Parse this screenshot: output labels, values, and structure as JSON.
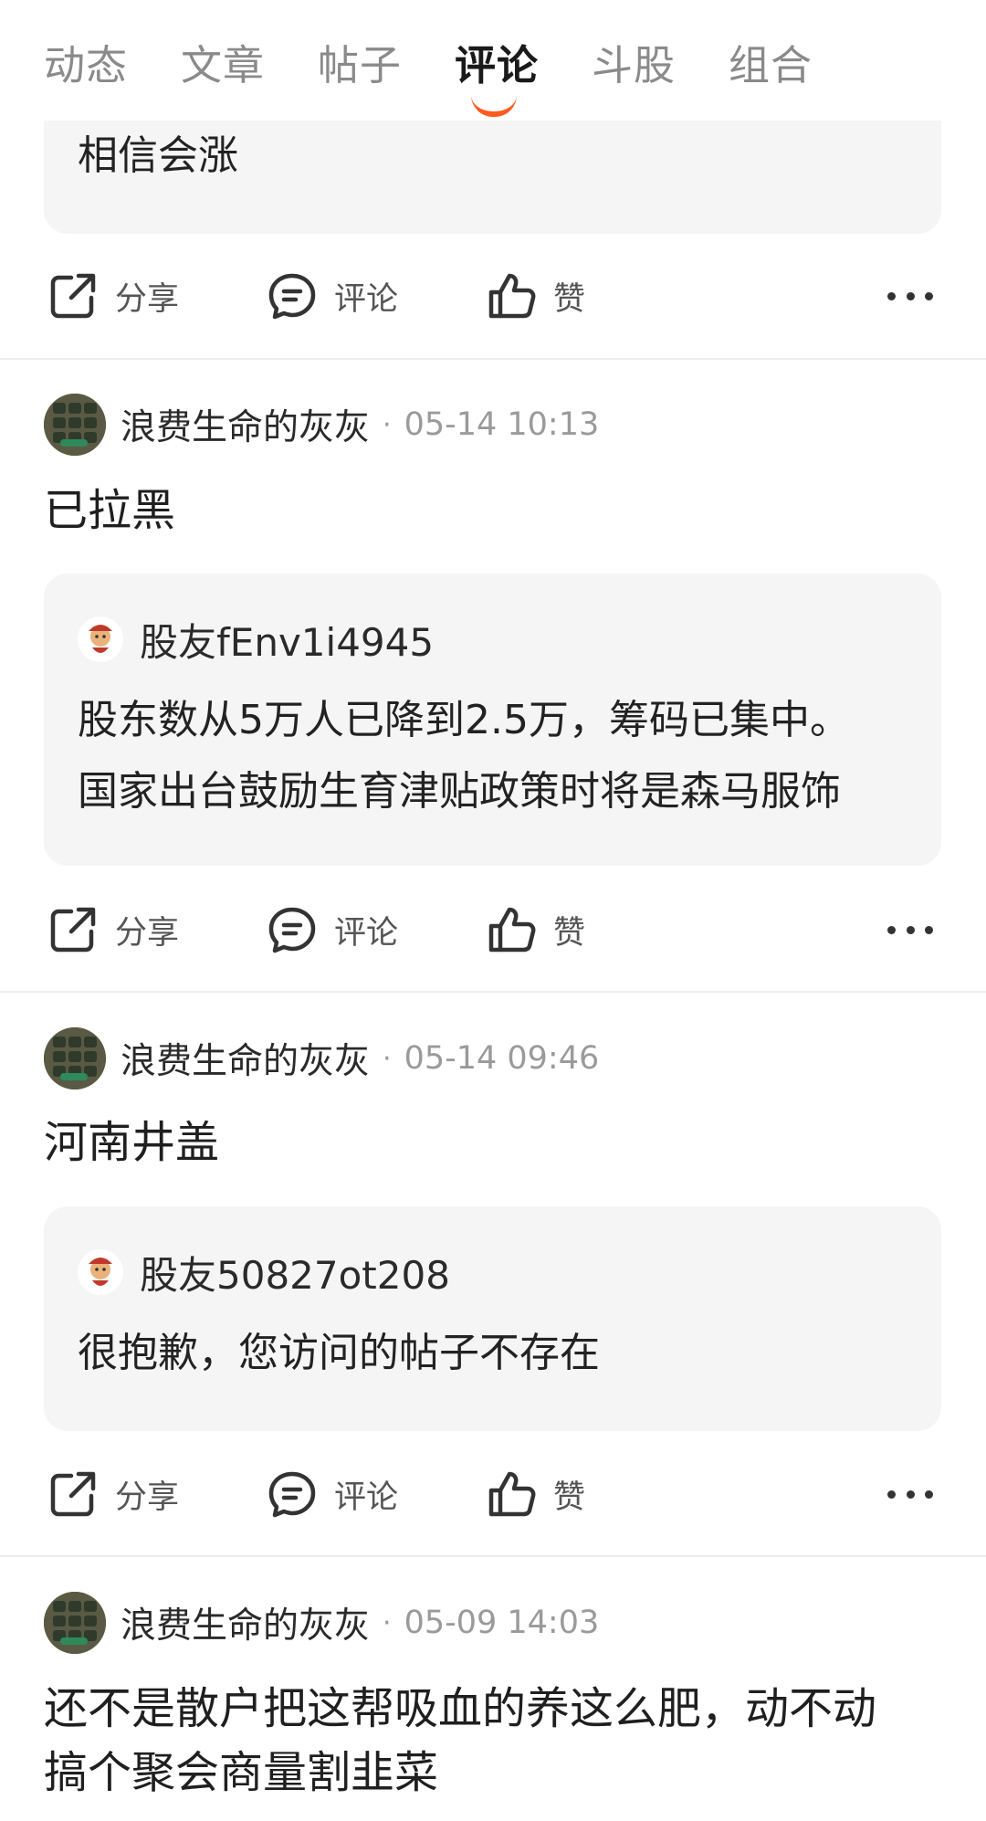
{
  "tabs": [
    {
      "label": "动态"
    },
    {
      "label": "文章"
    },
    {
      "label": "帖子"
    },
    {
      "label": "评论",
      "active": true
    },
    {
      "label": "斗股"
    },
    {
      "label": "组合"
    }
  ],
  "actions": {
    "share": "分享",
    "comment": "评论",
    "like": "赞"
  },
  "items": [
    {
      "quote": {
        "text_lines": [
          "相信会涨"
        ]
      }
    },
    {
      "author": "浪费生命的灰灰",
      "time": "05-14 10:13",
      "text_lines": [
        "已拉黑"
      ],
      "quote": {
        "author": "股友fEnv1i4945",
        "text_lines": [
          "股东数从5万人已降到2.5万，筹码已集中。",
          "国家出台鼓励生育津贴政策时将是森马服饰"
        ]
      }
    },
    {
      "author": "浪费生命的灰灰",
      "time": "05-14 09:46",
      "text_lines": [
        "河南井盖"
      ],
      "quote": {
        "author": "股友50827ot208",
        "text_lines": [
          "很抱歉，您访问的帖子不存在"
        ]
      }
    },
    {
      "author": "浪费生命的灰灰",
      "time": "05-09 14:03",
      "text_lines": [
        "还不是散户把这帮吸血的养这么肥，动不动",
        "搞个聚会商量割韭菜"
      ]
    }
  ],
  "colors": {
    "accent": "#ff5a1f",
    "quote_bg": "#f5f5f6"
  },
  "icons": [
    "share-icon",
    "comment-icon",
    "like-icon",
    "more-icon"
  ]
}
